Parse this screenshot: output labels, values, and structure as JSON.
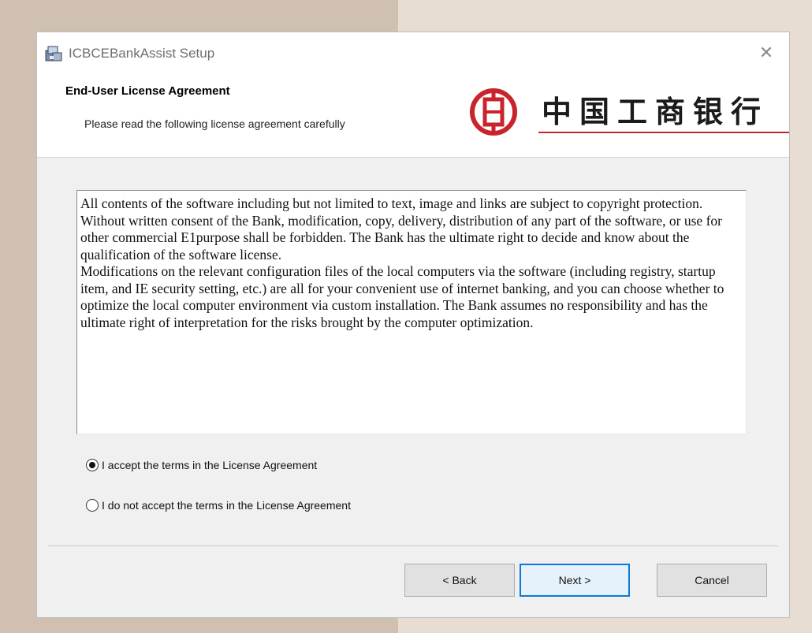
{
  "window": {
    "title": "ICBCEBankAssist Setup",
    "close_glyph": "✕"
  },
  "header": {
    "title": "End-User License Agreement",
    "subtitle": "Please read the following license agreement carefully",
    "logo_text": "中国工商银行",
    "logo_color": "#c9242b"
  },
  "license": {
    "paragraphs": [
      "All contents of the software including but not limited to text, image and links are subject to copyright protection. Without written consent of the Bank, modification, copy, delivery, distribution of any part of the software, or use for other commercial E1purpose shall be forbidden. The Bank has the ultimate right to decide and know about the qualification of the software license.",
      "Modifications on the relevant configuration files of the local computers via the software (including registry, startup item, and IE security setting, etc.) are all for your convenient use of internet banking, and you can choose whether to optimize the local computer environment via custom installation. The Bank assumes no responsibility and has the ultimate right of interpretation for the risks brought by the computer optimization."
    ]
  },
  "options": {
    "accept_label": "I accept the terms in the License Agreement",
    "decline_label": "I do not accept the terms in the License Agreement",
    "selected": "accept"
  },
  "buttons": {
    "back": "< Back",
    "next": "Next >",
    "cancel": "Cancel"
  },
  "icons": {
    "app": "installer-icon",
    "close": "close-icon",
    "logo": "icbc-logo-icon"
  }
}
